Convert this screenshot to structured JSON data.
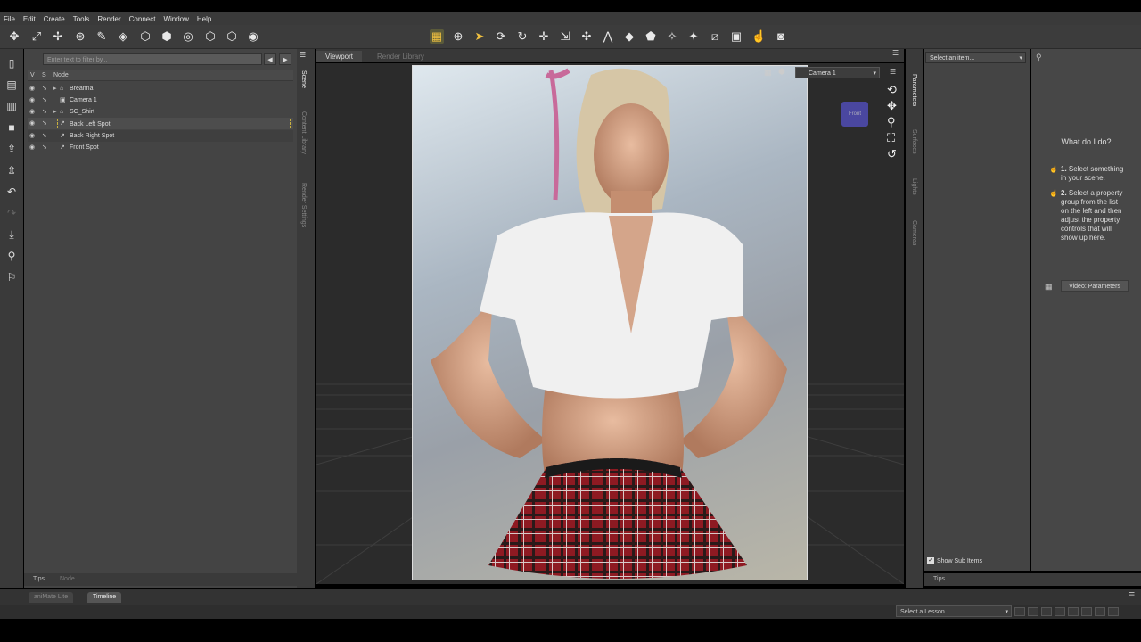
{
  "menu": [
    "File",
    "Edit",
    "Create",
    "Tools",
    "Render",
    "Connect",
    "Window",
    "Help"
  ],
  "toolbar_icons": [
    "node-selection-icon",
    "joint-editor-icon",
    "transform-icon",
    "universal-tool-icon",
    "surface-selection-icon",
    "geometry-editor-icon",
    "node-weight-icon",
    "region-icon",
    "rig-icon",
    "spot-render-icon",
    "pose-tool-icon",
    "active-pose-icon",
    "camera-icon",
    "pointer-icon",
    "orbit-icon",
    "rotate-icon",
    "translate-icon",
    "scale-icon",
    "twist-icon",
    "bend-icon",
    "morph-icon",
    "paint-icon",
    "brush-icon",
    "select-icon",
    "region-select-icon",
    "frame-icon",
    "snapshot-icon"
  ],
  "scene": {
    "filter_placeholder": "Enter text to filter by...",
    "col_v": "V",
    "col_s": "S",
    "col_node": "Node",
    "nodes": [
      {
        "label": "Breanna",
        "icon": "figure-icon"
      },
      {
        "label": "Camera 1",
        "icon": "camera-icon"
      },
      {
        "label": "SC_Shirt",
        "icon": "figure-icon"
      },
      {
        "label": "Back Left Spot",
        "icon": "spotlight-icon"
      },
      {
        "label": "Back Right Spot",
        "icon": "spotlight-icon"
      },
      {
        "label": "Front Spot",
        "icon": "spotlight-icon"
      }
    ],
    "tabs": [
      "Tips",
      "Node"
    ]
  },
  "side_tabs_left": [
    "Scene",
    "Content Library",
    "Render Settings"
  ],
  "viewport": {
    "tabs": [
      "Viewport",
      "Render Library"
    ],
    "camera": "Camera 1",
    "cube_label": "Front"
  },
  "side_tabs_right": [
    "Parameters",
    "Surfaces",
    "Lights",
    "Cameras"
  ],
  "params": {
    "select_placeholder": "Select an item...",
    "show_sub_items": "Show Sub Items"
  },
  "tips": {
    "title": "What do I do?",
    "step1_num": "1.",
    "step1": [
      "Select something",
      "in your scene."
    ],
    "step2_num": "2.",
    "step2": [
      "Select a property",
      "group from the list",
      "on the left and then",
      "adjust the property",
      "controls that will",
      "show up here."
    ],
    "video": "Video: Parameters",
    "tab": "Tips"
  },
  "bottom_tabs": [
    "aniMate Lite",
    "Timeline"
  ],
  "lesson_placeholder": "Select a Lesson..."
}
